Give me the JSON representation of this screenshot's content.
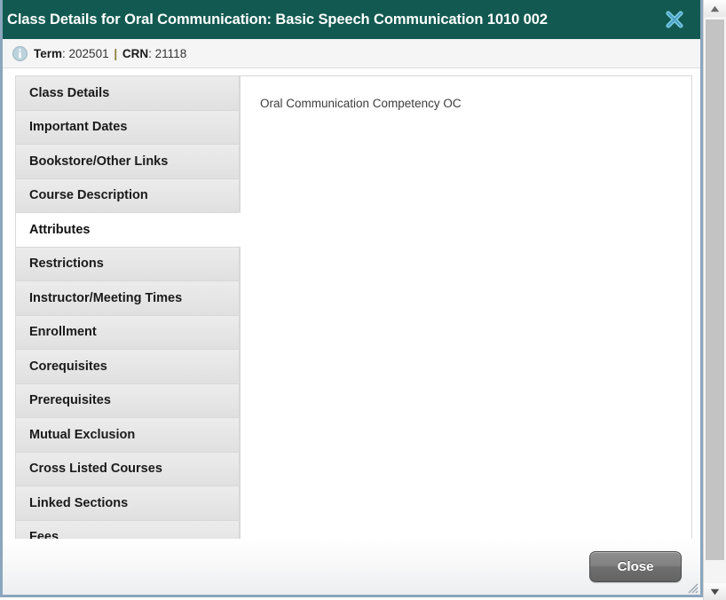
{
  "dialog": {
    "title": "Class Details for Oral Communication: Basic Speech Communication 1010 002",
    "close_icon_label": "X",
    "accent_color": "#125a51",
    "border_color": "#8ba6bd"
  },
  "info_bar": {
    "icon": "info-icon",
    "term_label": "Term",
    "term_value": "202501",
    "separator": "|",
    "crn_label": "CRN",
    "crn_value": "21118"
  },
  "tabs": [
    {
      "label": "Class Details",
      "active": false
    },
    {
      "label": "Important Dates",
      "active": false
    },
    {
      "label": "Bookstore/Other Links",
      "active": false
    },
    {
      "label": "Course Description",
      "active": false
    },
    {
      "label": "Attributes",
      "active": true
    },
    {
      "label": "Restrictions",
      "active": false
    },
    {
      "label": "Instructor/Meeting Times",
      "active": false
    },
    {
      "label": "Enrollment",
      "active": false
    },
    {
      "label": "Corequisites",
      "active": false
    },
    {
      "label": "Prerequisites",
      "active": false
    },
    {
      "label": "Mutual Exclusion",
      "active": false
    },
    {
      "label": "Cross Listed Courses",
      "active": false
    },
    {
      "label": "Linked Sections",
      "active": false
    },
    {
      "label": "Fees",
      "active": false
    }
  ],
  "content": {
    "lines": [
      "Oral Communication Competency OC"
    ]
  },
  "footer": {
    "close_label": "Close"
  },
  "scrollbar": {
    "up_arrow": "scroll-up-icon",
    "down_arrow": "scroll-down-icon"
  }
}
